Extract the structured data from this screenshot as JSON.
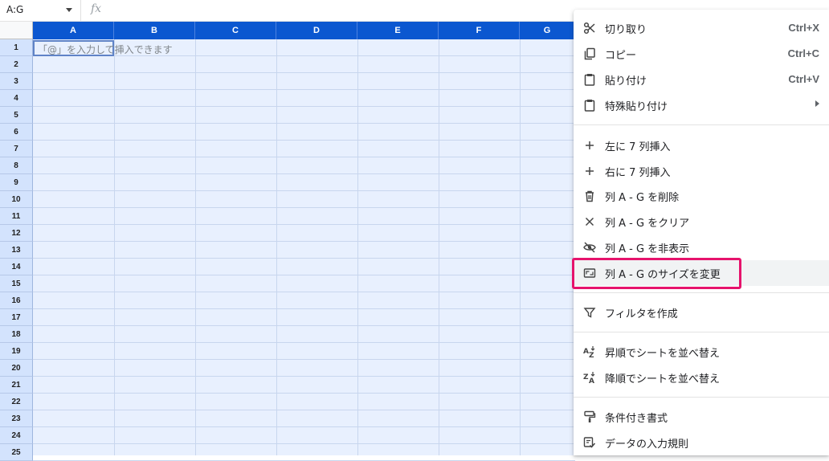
{
  "formula_bar": {
    "name_box": "A:G",
    "fx": "fx"
  },
  "columns": [
    "A",
    "B",
    "C",
    "D",
    "E",
    "F",
    "G"
  ],
  "rows": [
    "1",
    "2",
    "3",
    "4",
    "5",
    "6",
    "7",
    "8",
    "9",
    "10",
    "11",
    "12",
    "13",
    "14",
    "15",
    "16",
    "17",
    "18",
    "19",
    "20",
    "21",
    "22",
    "23",
    "24",
    "25"
  ],
  "cell_hint": "「@」を入力して挿入できます",
  "colors": {
    "header_selected": "#0b57d0",
    "row_header_selected": "#d3e3fd",
    "selection_fill": "#e8f0fe",
    "annotation": "#e6136c"
  },
  "context_menu": {
    "cut": {
      "label": "切り取り",
      "shortcut": "Ctrl+X",
      "icon": "scissors-icon"
    },
    "copy": {
      "label": "コピー",
      "shortcut": "Ctrl+C",
      "icon": "copy-icon"
    },
    "paste": {
      "label": "貼り付け",
      "shortcut": "Ctrl+V",
      "icon": "clipboard-icon"
    },
    "paste_special": {
      "label": "特殊貼り付け",
      "icon": "clipboard-icon"
    },
    "insert_left": {
      "label": "左に 7 列挿入",
      "icon": "plus-icon"
    },
    "insert_right": {
      "label": "右に 7 列挿入",
      "icon": "plus-icon"
    },
    "delete": {
      "label": "列 A - G を削除",
      "icon": "trash-icon"
    },
    "clear": {
      "label": "列 A - G をクリア",
      "icon": "x-icon"
    },
    "hide": {
      "label": "列 A - G を非表示",
      "icon": "eye-off-icon"
    },
    "resize": {
      "label": "列 A - G のサイズを変更",
      "icon": "resize-icon"
    },
    "filter": {
      "label": "フィルタを作成",
      "icon": "filter-icon"
    },
    "sort_asc": {
      "label": "昇順でシートを並べ替え",
      "icon": "sort-az-icon"
    },
    "sort_desc": {
      "label": "降順でシートを並べ替え",
      "icon": "sort-za-icon"
    },
    "cond_format": {
      "label": "条件付き書式",
      "icon": "paint-roller-icon"
    },
    "validation": {
      "label": "データの入力規則",
      "icon": "data-validation-icon"
    }
  }
}
